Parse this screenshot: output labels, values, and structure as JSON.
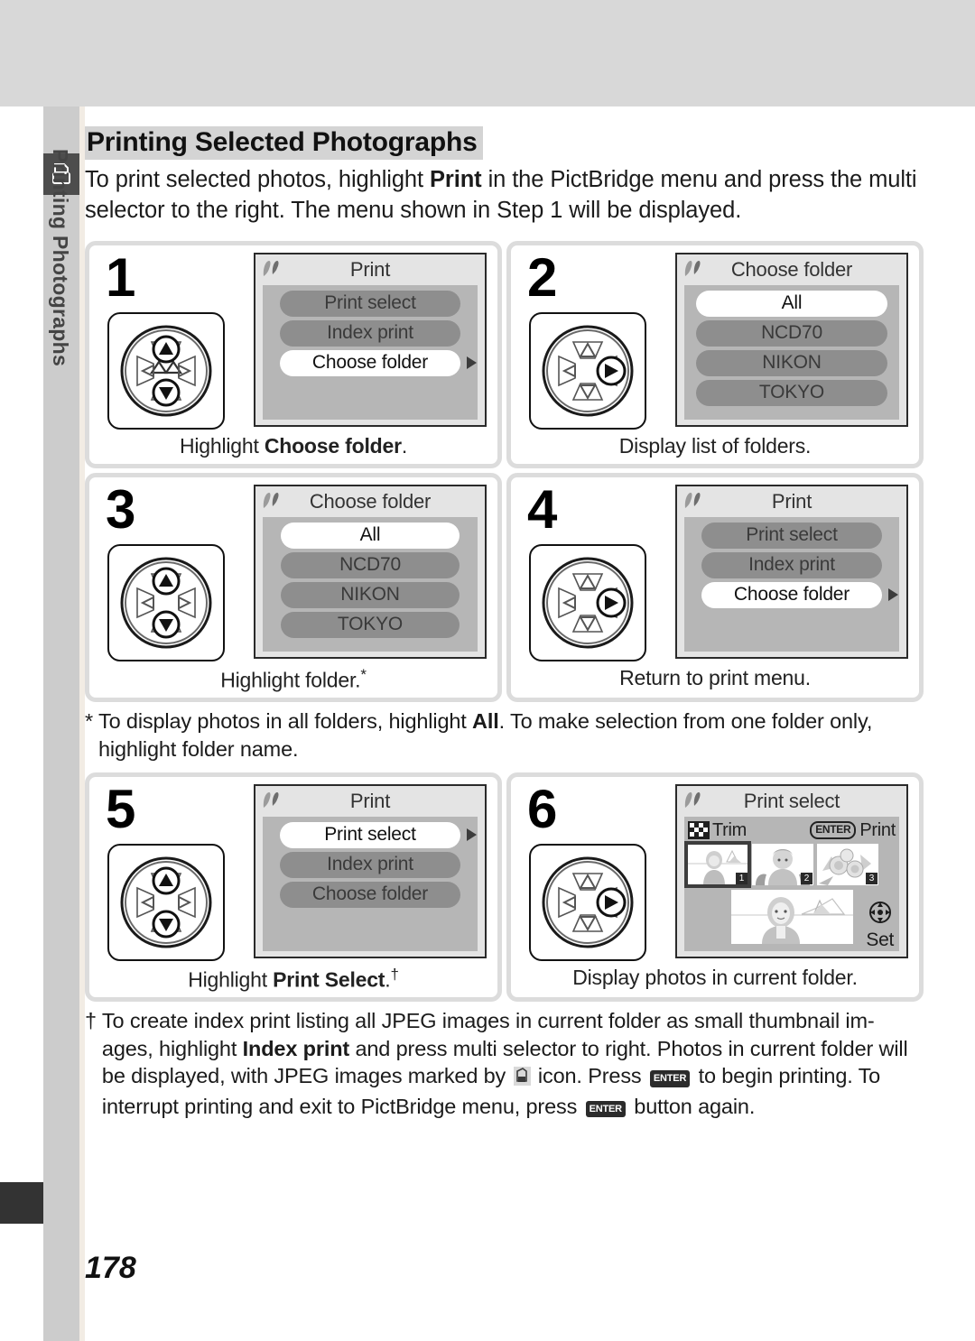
{
  "sidebar": {
    "tab_label": "Printing Photographs",
    "icon": "printer-icon"
  },
  "header": {
    "title": "Printing Selected Photographs"
  },
  "intro": {
    "before_bold": "To print selected photos, highlight ",
    "bold": "Print",
    "after_bold": " in the PictBridge menu and press the multi selector to the right.  The menu shown in Step 1 will be displayed."
  },
  "steps": [
    {
      "number": "1",
      "dial": "up-down",
      "screen_title": "Print",
      "screen_type": "menu",
      "items": [
        {
          "label": "Print select",
          "selected": false,
          "arrow": false
        },
        {
          "label": "Index print",
          "selected": false,
          "arrow": false
        },
        {
          "label": "Choose folder",
          "selected": true,
          "arrow": true
        }
      ],
      "caption_before": "Highlight ",
      "caption_bold": "Choose folder",
      "caption_after": ".",
      "caption_sup": ""
    },
    {
      "number": "2",
      "dial": "right",
      "screen_title": "Choose folder",
      "screen_type": "menu",
      "items": [
        {
          "label": "All",
          "selected": true,
          "arrow": false
        },
        {
          "label": "NCD70",
          "selected": false,
          "arrow": false
        },
        {
          "label": "NIKON",
          "selected": false,
          "arrow": false
        },
        {
          "label": "TOKYO",
          "selected": false,
          "arrow": false
        }
      ],
      "caption_before": "Display list of folders.",
      "caption_bold": "",
      "caption_after": "",
      "caption_sup": ""
    },
    {
      "number": "3",
      "dial": "up-down",
      "screen_title": "Choose folder",
      "screen_type": "menu",
      "items": [
        {
          "label": "All",
          "selected": true,
          "arrow": false
        },
        {
          "label": "NCD70",
          "selected": false,
          "arrow": false
        },
        {
          "label": "NIKON",
          "selected": false,
          "arrow": false
        },
        {
          "label": "TOKYO",
          "selected": false,
          "arrow": false
        }
      ],
      "caption_before": "Highlight folder.",
      "caption_bold": "",
      "caption_after": "",
      "caption_sup": "*"
    },
    {
      "number": "4",
      "dial": "right",
      "screen_title": "Print",
      "screen_type": "menu",
      "items": [
        {
          "label": "Print select",
          "selected": false,
          "arrow": false
        },
        {
          "label": "Index print",
          "selected": false,
          "arrow": false
        },
        {
          "label": "Choose folder",
          "selected": true,
          "arrow": true
        }
      ],
      "caption_before": "Return to print menu.",
      "caption_bold": "",
      "caption_after": "",
      "caption_sup": ""
    },
    {
      "number": "5",
      "dial": "up-down",
      "screen_title": "Print",
      "screen_type": "menu",
      "items": [
        {
          "label": "Print select",
          "selected": true,
          "arrow": true
        },
        {
          "label": "Index print",
          "selected": false,
          "arrow": false
        },
        {
          "label": "Choose folder",
          "selected": false,
          "arrow": false
        }
      ],
      "caption_before": "Highlight ",
      "caption_bold": "Print Select",
      "caption_after": ".",
      "caption_sup": "†"
    },
    {
      "number": "6",
      "dial": "right",
      "screen_title": "Print select",
      "screen_type": "print-select",
      "trim_label": "Trim",
      "enter_label": "ENTER",
      "print_label": "Print",
      "set_label": "Set",
      "thumbnails": [
        {
          "badge": "1",
          "active": true
        },
        {
          "badge": "2",
          "active": false
        },
        {
          "badge": "3",
          "active": false
        }
      ],
      "caption_before": "Display photos in current folder.",
      "caption_bold": "",
      "caption_after": "",
      "caption_sup": ""
    }
  ],
  "footnotes": [
    {
      "mark": "*",
      "part1": "To display photos in all folders, highlight ",
      "bold1": "All",
      "part2": ".  To make selection from one folder only, highlight folder name.",
      "bold2": "",
      "part3": "",
      "bold3": "",
      "part4": ""
    },
    {
      "mark": "†",
      "part1": "To create index print listing all JPEG images in current folder as small thumbnail im-ages, highlight ",
      "bold1": "Index print",
      "part2": " and press multi selector to right.  Photos in current folder will be displayed, with JPEG images marked by ",
      "bold2": "",
      "part3": " icon.  Press ",
      "bold3": "ENTER",
      "part4": " to begin printing. To interrupt printing and exit to PictBridge menu, press ",
      "bold4": "ENTER",
      "part5": " button again."
    }
  ],
  "page_number": "178"
}
